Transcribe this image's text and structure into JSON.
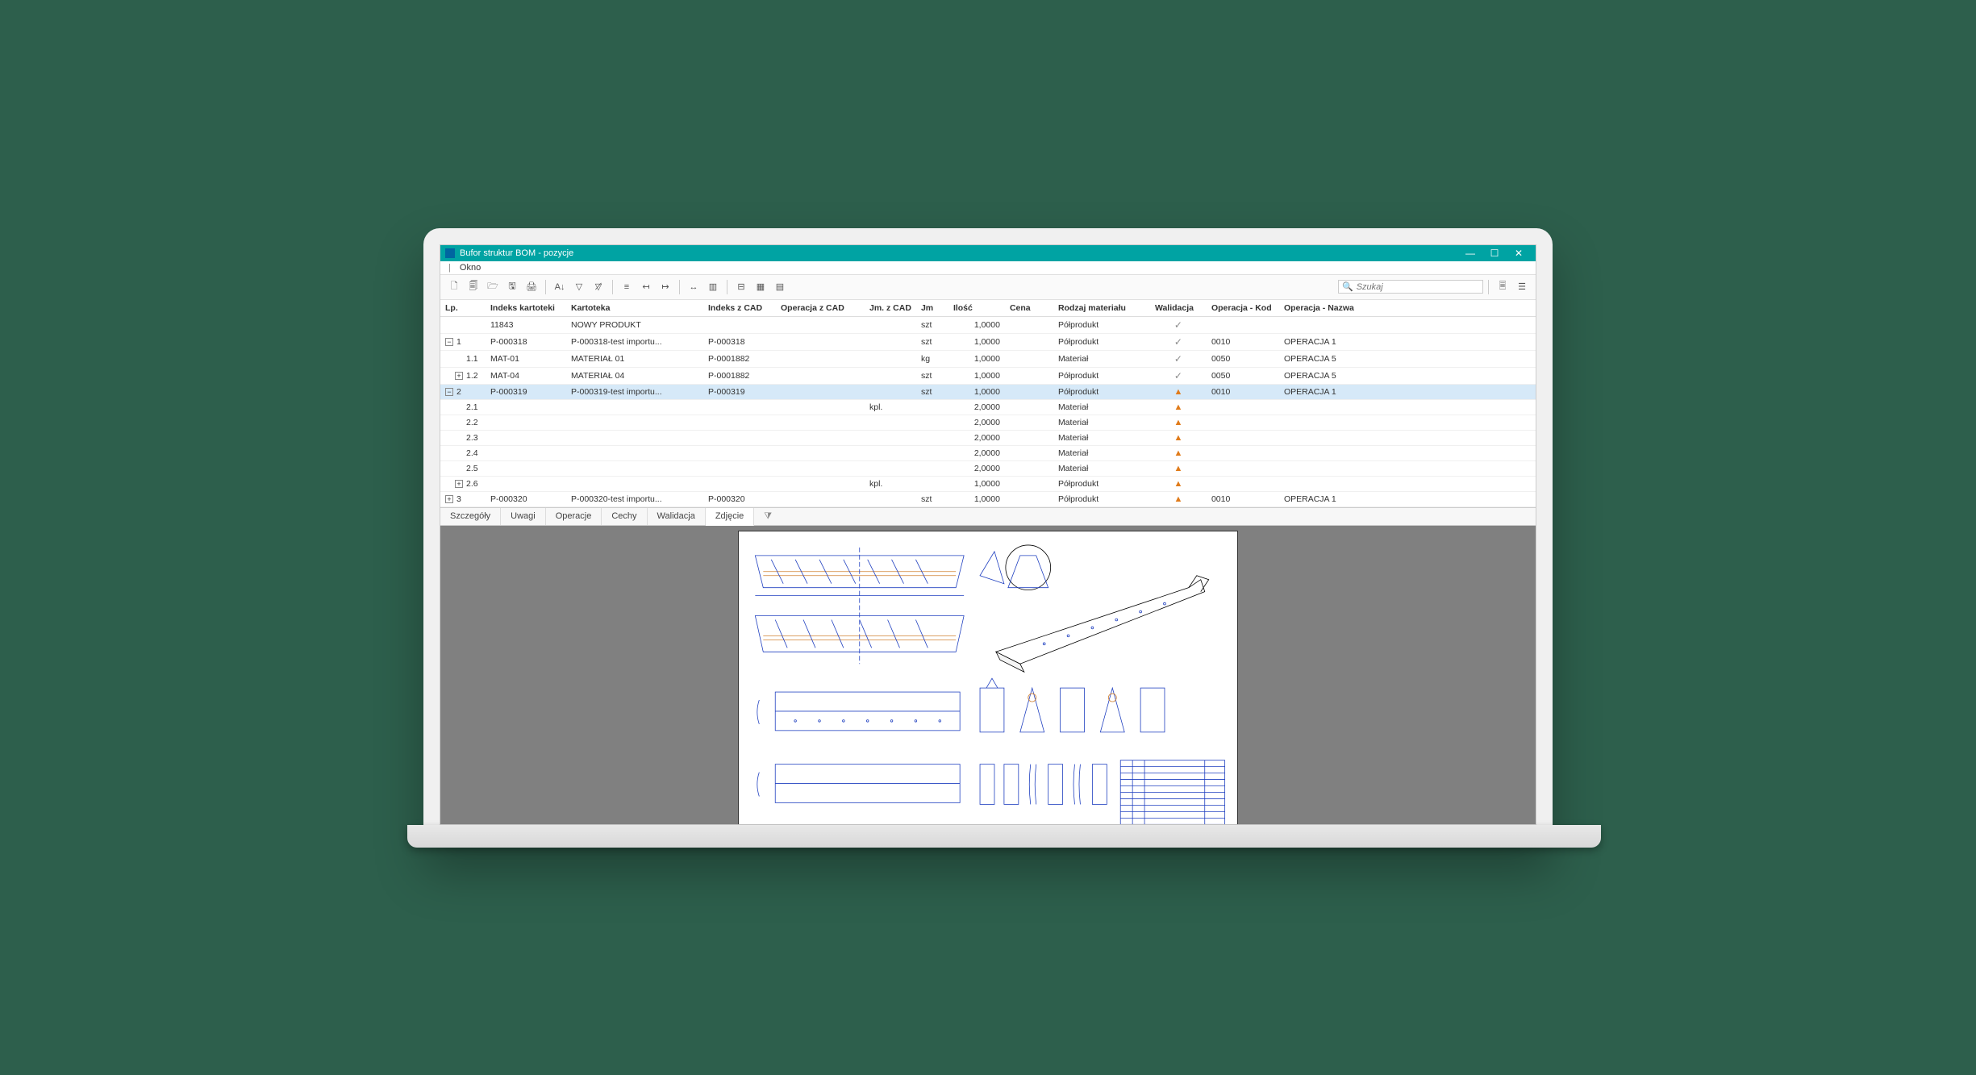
{
  "window": {
    "title": "Bufor struktur BOM - pozycje"
  },
  "menu": {
    "okno": "Okno"
  },
  "search": {
    "placeholder": "Szukaj"
  },
  "columns": {
    "lp": "Lp.",
    "indeks_kartoteki": "Indeks kartoteki",
    "kartoteka": "Kartoteka",
    "indeks_z_cad": "Indeks z CAD",
    "operacja_z_cad": "Operacja z CAD",
    "jm_z_cad": "Jm. z CAD",
    "jm": "Jm",
    "ilosc": "Ilość",
    "cena": "Cena",
    "rodzaj_materialu": "Rodzaj materiału",
    "walidacja": "Walidacja",
    "operacja_kod": "Operacja - Kod",
    "operacja_nazwa": "Operacja - Nazwa"
  },
  "rows": [
    {
      "exp": "",
      "lp": "",
      "indeks": "11843",
      "kart": "NOWY PRODUKT",
      "icad": "",
      "ocad": "",
      "jmcad": "",
      "jm": "szt",
      "ilosc": "1,0000",
      "cena": "",
      "rodzaj": "Półprodukt",
      "valid": "ok",
      "okod": "",
      "onaz": "",
      "sel": false
    },
    {
      "exp": "-",
      "lp": "1",
      "indeks": "P-000318",
      "kart": "P-000318-test importu...",
      "icad": "P-000318",
      "ocad": "",
      "jmcad": "",
      "jm": "szt",
      "ilosc": "1,0000",
      "cena": "",
      "rodzaj": "Półprodukt",
      "valid": "ok",
      "okod": "0010",
      "onaz": "OPERACJA 1",
      "sel": false
    },
    {
      "exp": "",
      "lp": "1.1",
      "indeks": "MAT-01",
      "kart": "MATERIAŁ 01",
      "icad": "P-0001882",
      "ocad": "",
      "jmcad": "",
      "jm": "kg",
      "ilosc": "1,0000",
      "cena": "",
      "rodzaj": "Materiał",
      "valid": "ok",
      "okod": "0050",
      "onaz": "OPERACJA 5",
      "sel": false
    },
    {
      "exp": "+",
      "lp": "1.2",
      "indeks": "MAT-04",
      "kart": "MATERIAŁ 04",
      "icad": "P-0001882",
      "ocad": "",
      "jmcad": "",
      "jm": "szt",
      "ilosc": "1,0000",
      "cena": "",
      "rodzaj": "Półprodukt",
      "valid": "ok",
      "okod": "0050",
      "onaz": "OPERACJA 5",
      "sel": false
    },
    {
      "exp": "-",
      "lp": "2",
      "indeks": "P-000319",
      "kart": "P-000319-test importu...",
      "icad": "P-000319",
      "ocad": "",
      "jmcad": "",
      "jm": "szt",
      "ilosc": "1,0000",
      "cena": "",
      "rodzaj": "Półprodukt",
      "valid": "warn",
      "okod": "0010",
      "onaz": "OPERACJA 1",
      "sel": true
    },
    {
      "exp": "",
      "lp": "2.1",
      "indeks": "",
      "kart": "",
      "icad": "",
      "ocad": "",
      "jmcad": "kpl.",
      "jm": "",
      "ilosc": "2,0000",
      "cena": "",
      "rodzaj": "Materiał",
      "valid": "warn",
      "okod": "",
      "onaz": "",
      "sel": false
    },
    {
      "exp": "",
      "lp": "2.2",
      "indeks": "",
      "kart": "",
      "icad": "",
      "ocad": "",
      "jmcad": "",
      "jm": "",
      "ilosc": "2,0000",
      "cena": "",
      "rodzaj": "Materiał",
      "valid": "warn",
      "okod": "",
      "onaz": "",
      "sel": false
    },
    {
      "exp": "",
      "lp": "2.3",
      "indeks": "",
      "kart": "",
      "icad": "",
      "ocad": "",
      "jmcad": "",
      "jm": "",
      "ilosc": "2,0000",
      "cena": "",
      "rodzaj": "Materiał",
      "valid": "warn",
      "okod": "",
      "onaz": "",
      "sel": false
    },
    {
      "exp": "",
      "lp": "2.4",
      "indeks": "",
      "kart": "",
      "icad": "",
      "ocad": "",
      "jmcad": "",
      "jm": "",
      "ilosc": "2,0000",
      "cena": "",
      "rodzaj": "Materiał",
      "valid": "warn",
      "okod": "",
      "onaz": "",
      "sel": false
    },
    {
      "exp": "",
      "lp": "2.5",
      "indeks": "",
      "kart": "",
      "icad": "",
      "ocad": "",
      "jmcad": "",
      "jm": "",
      "ilosc": "2,0000",
      "cena": "",
      "rodzaj": "Materiał",
      "valid": "warn",
      "okod": "",
      "onaz": "",
      "sel": false
    },
    {
      "exp": "+",
      "lp": "2.6",
      "indeks": "",
      "kart": "",
      "icad": "",
      "ocad": "",
      "jmcad": "kpl.",
      "jm": "",
      "ilosc": "1,0000",
      "cena": "",
      "rodzaj": "Półprodukt",
      "valid": "warn",
      "okod": "",
      "onaz": "",
      "sel": false
    },
    {
      "exp": "+",
      "lp": "3",
      "indeks": "P-000320",
      "kart": "P-000320-test importu...",
      "icad": "P-000320",
      "ocad": "",
      "jmcad": "",
      "jm": "szt",
      "ilosc": "1,0000",
      "cena": "",
      "rodzaj": "Półprodukt",
      "valid": "warn",
      "okod": "0010",
      "onaz": "OPERACJA 1",
      "sel": false
    }
  ],
  "tabs": {
    "szczegoly": "Szczegóły",
    "uwagi": "Uwagi",
    "operacje": "Operacje",
    "cechy": "Cechy",
    "walidacja": "Walidacja",
    "zdjecie": "Zdjęcie"
  }
}
